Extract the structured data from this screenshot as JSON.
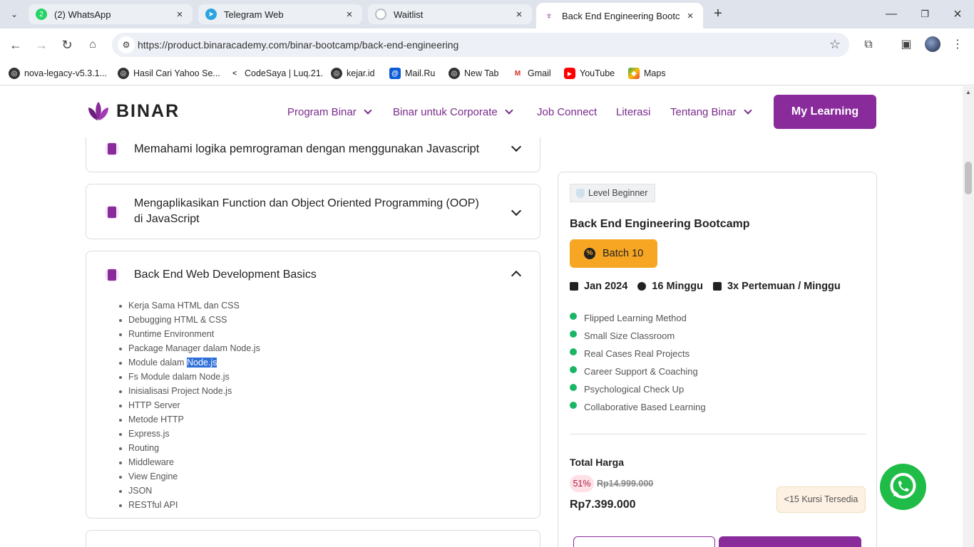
{
  "browser": {
    "tabs": [
      {
        "label": "(2) WhatsApp",
        "icon": "whatsapp-icon",
        "color": "#25d366",
        "badge": "2"
      },
      {
        "label": "Telegram Web",
        "icon": "telegram-icon",
        "color": "#2aa3e0",
        "badge": "➤"
      },
      {
        "label": "Waitlist",
        "icon": "loading-icon",
        "color": "#b8bcc4",
        "badge": ""
      },
      {
        "label": "Back End Engineering Bootcam",
        "icon": "binar-icon",
        "color": "#8a2b9b",
        "badge": "♆"
      }
    ],
    "url": "https://product.binaracademy.com/binar-bootcamp/back-end-engineering",
    "bookmarks": [
      {
        "label": "nova-legacy-v5.3.1...",
        "icon": "globe-icon",
        "glyph": "",
        "color": "#333"
      },
      {
        "label": "Hasil Cari Yahoo Se...",
        "icon": "globe-icon",
        "glyph": "",
        "color": "#333"
      },
      {
        "label": "CodeSaya | Luq.21.",
        "icon": "code-icon",
        "glyph": "<",
        "color": "#fff"
      },
      {
        "label": "kejar.id",
        "icon": "globe-icon",
        "glyph": "",
        "color": "#333"
      },
      {
        "label": "Mail.Ru",
        "icon": "mailru-icon",
        "glyph": "@",
        "color": "#0a5bd8"
      },
      {
        "label": "New Tab",
        "icon": "globe-icon",
        "glyph": "",
        "color": "#333"
      },
      {
        "label": "Gmail",
        "icon": "gmail-icon",
        "glyph": "M",
        "color": "#fff"
      },
      {
        "label": "YouTube",
        "icon": "youtube-icon",
        "glyph": "▶",
        "color": "#ff0000"
      },
      {
        "label": "Maps",
        "icon": "maps-icon",
        "glyph": "◆",
        "color": "#fff"
      }
    ]
  },
  "site": {
    "brand": "BINAR",
    "nav": [
      {
        "label": "Program Binar",
        "dropdown": true
      },
      {
        "label": "Binar untuk Corporate",
        "dropdown": true
      },
      {
        "label": "Job Connect",
        "dropdown": false
      },
      {
        "label": "Literasi",
        "dropdown": false
      },
      {
        "label": "Tentang Binar",
        "dropdown": true
      }
    ],
    "cta": "My Learning"
  },
  "curriculum": [
    {
      "title": "Memahami logika pemrograman dengan menggunakan Javascript",
      "expanded": false
    },
    {
      "title": "Mengaplikasikan Function dan Object Oriented Programming (OOP) di JavaScript",
      "expanded": false
    },
    {
      "title": "Back End Web Development Basics",
      "expanded": true,
      "topics": [
        "Kerja Sama HTML dan CSS",
        "Debugging HTML & CSS",
        "Runtime Environment",
        "Package Manager dalam Node.js",
        "Module dalam ",
        "Fs Module dalam Node.js",
        "Inisialisasi Project Node.js",
        "HTTP Server",
        "Metode HTTP",
        "Express.js",
        "Routing",
        "Middleware",
        "View Engine",
        "JSON",
        "RESTful API"
      ],
      "highlight": "Node.js"
    }
  ],
  "product": {
    "level": "Level Beginner",
    "title": "Back End Engineering Bootcamp",
    "batch": "Batch 10",
    "start": "Jan 2024",
    "duration": "16 Minggu",
    "frequency": "3x Pertemuan / Minggu",
    "features": [
      "Flipped Learning Method",
      "Small Size Classroom",
      "Real Cases Real Projects",
      "Career Support & Coaching",
      "Psychological Check Up",
      "Collaborative Based Learning"
    ],
    "total_label": "Total Harga",
    "discount": "51%",
    "old_price": "Rp14.999.000",
    "price": "Rp7.399.000",
    "seats": "<15 Kursi Tersedia"
  },
  "colors": {
    "brand": "#8a2b9b",
    "batch": "#f6a623",
    "check": "#1bb566",
    "whatsapp": "#1fbd48"
  }
}
